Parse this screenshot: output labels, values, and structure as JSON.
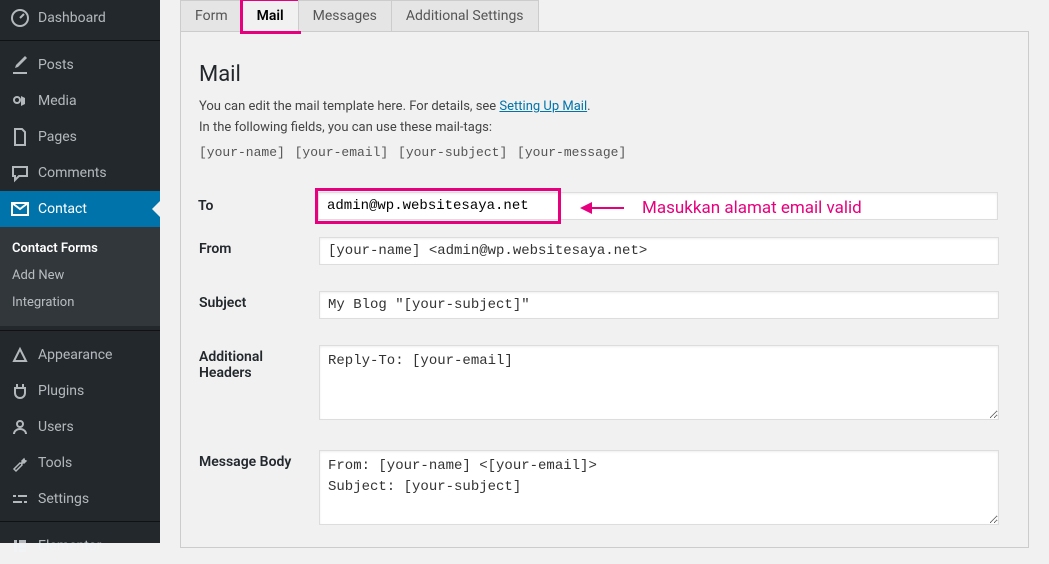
{
  "sidebar": {
    "items": [
      {
        "label": "Dashboard",
        "icon": "dashboard-icon"
      },
      {
        "label": "Posts",
        "icon": "posts-icon"
      },
      {
        "label": "Media",
        "icon": "media-icon"
      },
      {
        "label": "Pages",
        "icon": "pages-icon"
      },
      {
        "label": "Comments",
        "icon": "comments-icon"
      },
      {
        "label": "Contact",
        "icon": "contact-icon"
      },
      {
        "label": "Appearance",
        "icon": "appearance-icon"
      },
      {
        "label": "Plugins",
        "icon": "plugins-icon"
      },
      {
        "label": "Users",
        "icon": "users-icon"
      },
      {
        "label": "Tools",
        "icon": "tools-icon"
      },
      {
        "label": "Settings",
        "icon": "settings-icon"
      },
      {
        "label": "Elementor",
        "icon": "elementor-icon"
      }
    ],
    "submenu": [
      {
        "label": "Contact Forms"
      },
      {
        "label": "Add New"
      },
      {
        "label": "Integration"
      }
    ]
  },
  "tabs": [
    {
      "label": "Form"
    },
    {
      "label": "Mail"
    },
    {
      "label": "Messages"
    },
    {
      "label": "Additional Settings"
    }
  ],
  "panel": {
    "heading": "Mail",
    "intro_pre": "You can edit the mail template here. For details, see ",
    "intro_link": "Setting Up Mail",
    "intro_post": ".",
    "intro_line2": "In the following fields, you can use these mail-tags:",
    "mail_tags": "[your-name] [your-email] [your-subject] [your-message]"
  },
  "fields": {
    "to": {
      "label": "To",
      "value": "admin@wp.websitesaya.net"
    },
    "from": {
      "label": "From",
      "value": "[your-name] <admin@wp.websitesaya.net>"
    },
    "subject": {
      "label": "Subject",
      "value": "My Blog \"[your-subject]\""
    },
    "headers": {
      "label": "Additional Headers",
      "value": "Reply-To: [your-email]"
    },
    "body": {
      "label": "Message Body",
      "value": "From: [your-name] <[your-email]>\nSubject: [your-subject]"
    }
  },
  "annotation": {
    "text": "Masukkan alamat email valid"
  }
}
